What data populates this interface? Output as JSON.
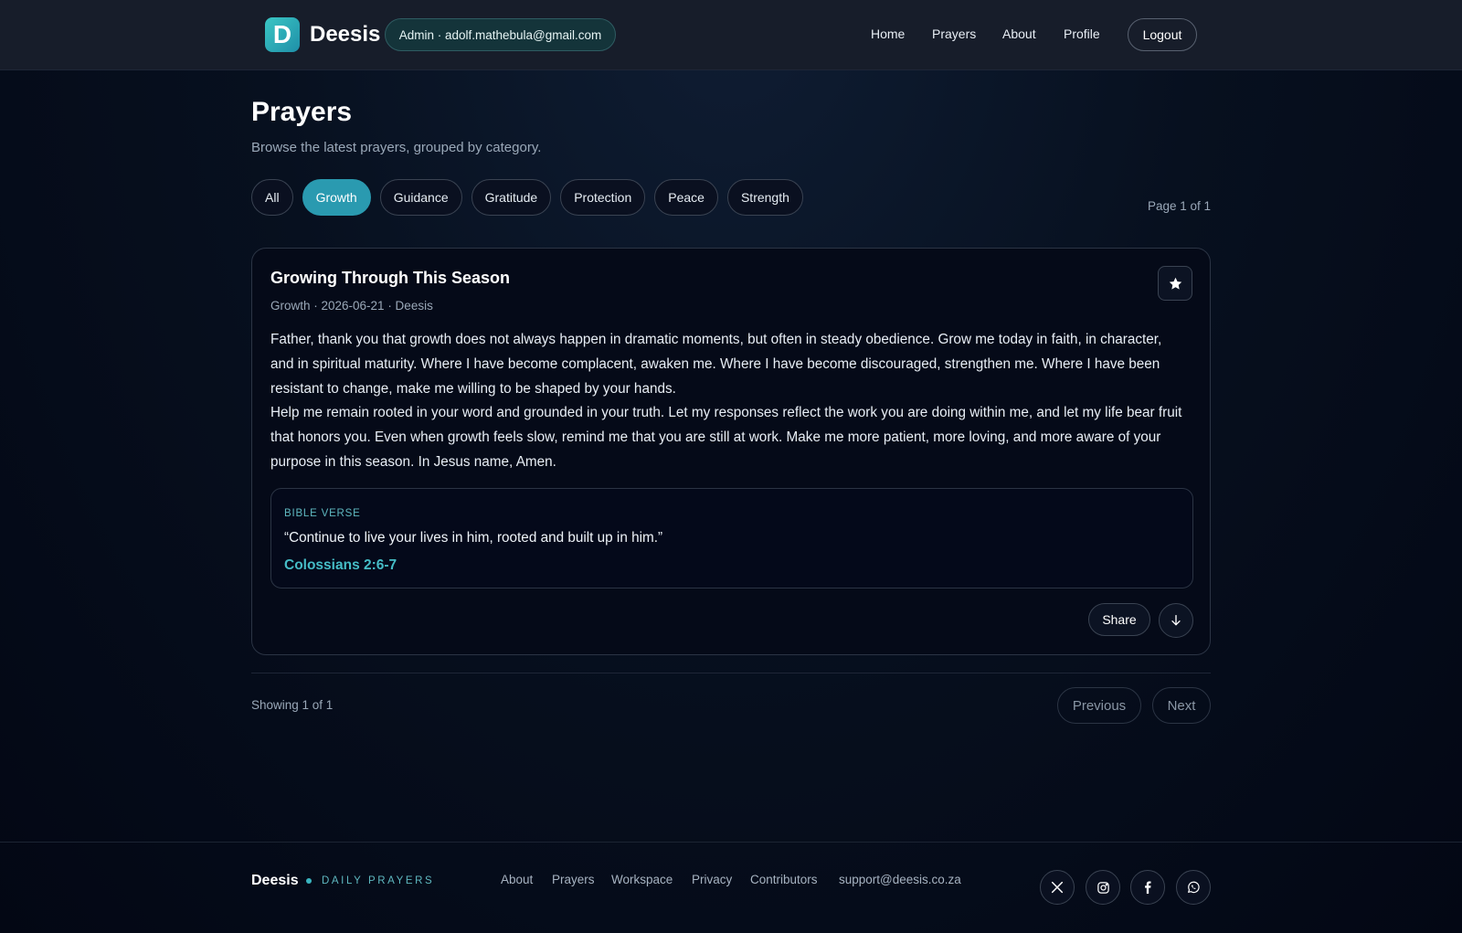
{
  "header": {
    "logo_letter": "D",
    "brand": "Deesis",
    "admin_badge": "Admin · adolf.mathebula@gmail.com",
    "nav": [
      "Home",
      "Prayers",
      "About",
      "Profile"
    ],
    "logout": "Logout"
  },
  "page": {
    "title": "Prayers",
    "subtitle": "Browse the latest prayers, grouped by category.",
    "filters": [
      "All",
      "Growth",
      "Guidance",
      "Gratitude",
      "Protection",
      "Peace",
      "Strength"
    ],
    "active_filter": "Growth",
    "page_indicator": "Page 1 of 1"
  },
  "prayer": {
    "title": "Growing Through This Season",
    "meta": "Growth · 2026-06-21 · Deesis",
    "paragraphs": [
      "Father, thank you that growth does not always happen in dramatic moments, but often in steady obedience. Grow me today in faith, in character, and in spiritual maturity. Where I have become complacent, awaken me. Where I have become discouraged, strengthen me. Where I have been resistant to change, make me willing to be shaped by your hands.",
      "Help me remain rooted in your word and grounded in your truth. Let my responses reflect the work you are doing within me, and let my life bear fruit that honors you. Even when growth feels slow, remind me that you are still at work. Make me more patient, more loving, and more aware of your purpose in this season. In Jesus name, Amen."
    ],
    "verse_label": "BIBLE VERSE",
    "verse_text": "“Continue to live your lives in him, rooted and built up in him.”",
    "verse_ref": "Colossians 2:6-7",
    "share": "Share",
    "favorite_icon": "star-icon",
    "download_icon": "arrow-down-icon"
  },
  "pagination": {
    "showing": "Showing 1 of 1",
    "previous": "Previous",
    "next": "Next"
  },
  "footer": {
    "brand": "Deesis",
    "tagline": "DAILY PRAYERS",
    "links": [
      "About",
      "Prayers",
      "Workspace",
      "Privacy",
      "Contributors",
      "support@deesis.co.za"
    ],
    "socials": [
      "x-icon",
      "instagram-icon",
      "facebook-icon",
      "whatsapp-icon"
    ]
  },
  "colors": {
    "accent": "#2a9ab0",
    "verse_ref": "#45bcc6",
    "background": "#050a18"
  }
}
